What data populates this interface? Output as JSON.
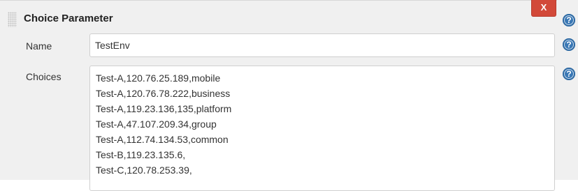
{
  "section": {
    "title": "Choice Parameter",
    "delete_label": "X",
    "help_glyph": "?"
  },
  "fields": {
    "name_label": "Name",
    "name_value": "TestEnv",
    "choices_label": "Choices",
    "choices": [
      "Test-A,120.76.25.189,mobile",
      "Test-A,120.76.78.222,business",
      "Test-A,119.23.136,135,platform",
      "Test-A,47.107.209.34,group",
      "Test-A,112.74.134.53,common",
      "Test-B,119.23.135.6,",
      "Test-C,120.78.253.39,"
    ]
  },
  "icons": {
    "drag": "drag-handle-icon",
    "help": "help-icon",
    "delete": "close-icon"
  },
  "colors": {
    "panel_bg": "#f0f0f0",
    "delete_bg": "#d24939",
    "help_bg": "#3a78b5",
    "input_border": "#cfcfcf"
  }
}
